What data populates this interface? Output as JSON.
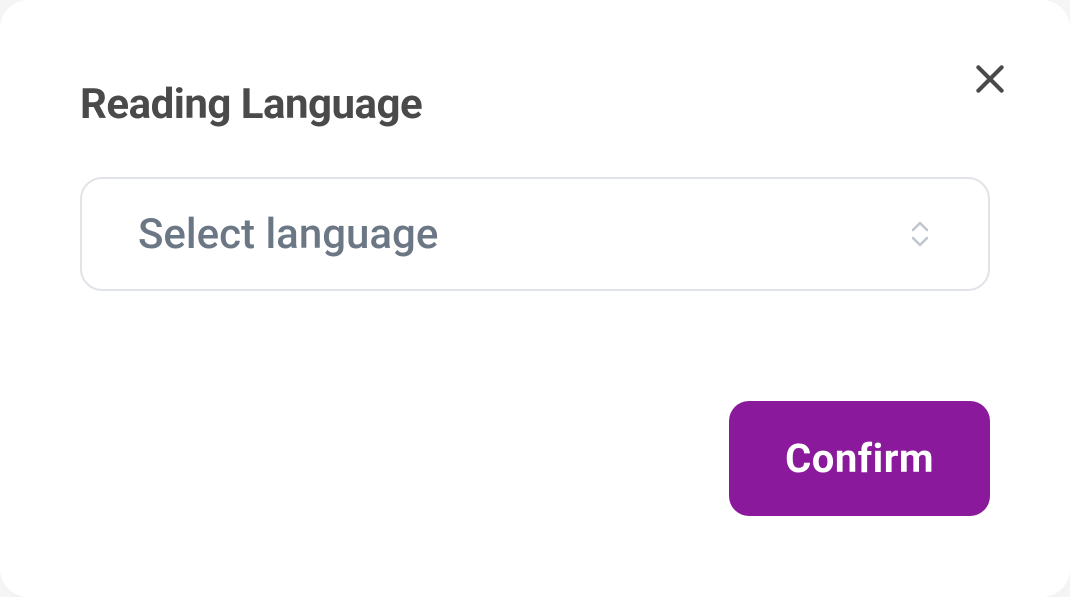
{
  "dialog": {
    "title": "Reading Language",
    "select": {
      "placeholder": "Select language"
    },
    "confirm_label": "Confirm"
  },
  "colors": {
    "accent": "#8a1a9b",
    "title_text": "#4a4a4a",
    "placeholder_text": "#6b7785",
    "border": "#e0e3e8"
  }
}
